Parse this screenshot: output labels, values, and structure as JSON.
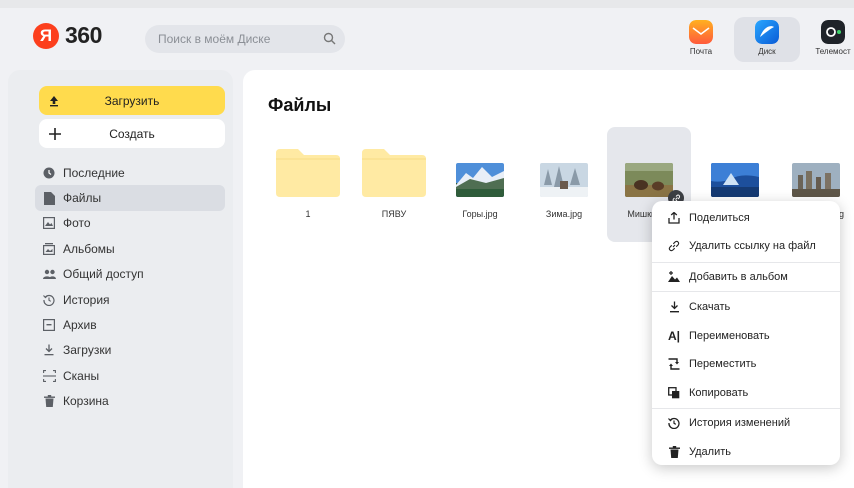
{
  "brand": {
    "logo_letter": "Я",
    "logo_text": "360"
  },
  "search": {
    "placeholder": "Поиск в моём Диске"
  },
  "apps": [
    {
      "label": "Почта",
      "icon": "mail-icon"
    },
    {
      "label": "Диск",
      "icon": "disk-icon",
      "active": true
    },
    {
      "label": "Телемост",
      "icon": "telemost-icon"
    }
  ],
  "sidebar": {
    "upload_label": "Загрузить",
    "create_label": "Создать",
    "items": [
      {
        "label": "Последние",
        "icon": "clock-icon"
      },
      {
        "label": "Файлы",
        "icon": "file-icon",
        "active": true
      },
      {
        "label": "Фото",
        "icon": "photo-icon"
      },
      {
        "label": "Альбомы",
        "icon": "albums-icon"
      },
      {
        "label": "Общий доступ",
        "icon": "shared-icon"
      },
      {
        "label": "История",
        "icon": "history-icon"
      },
      {
        "label": "Архив",
        "icon": "archive-icon"
      },
      {
        "label": "Загрузки",
        "icon": "downloads-icon"
      },
      {
        "label": "Сканы",
        "icon": "scan-icon"
      },
      {
        "label": "Корзина",
        "icon": "trash-icon"
      }
    ]
  },
  "main": {
    "title": "Файлы",
    "files": [
      {
        "name": "1",
        "kind": "folder"
      },
      {
        "name": "ПЯВУ",
        "kind": "folder"
      },
      {
        "name": "Горы.jpg",
        "kind": "image"
      },
      {
        "name": "Зима.jpg",
        "kind": "image"
      },
      {
        "name": "Мишки.jpg",
        "kind": "image",
        "selected": true
      },
      {
        "name": "",
        "kind": "image"
      },
      {
        "name": "g",
        "kind": "image"
      }
    ]
  },
  "context_menu": {
    "items": [
      {
        "label": "Поделиться",
        "icon": "share-icon"
      },
      {
        "label": "Удалить ссылку на файл",
        "icon": "unlink-icon"
      },
      {
        "label": "Добавить в альбом",
        "icon": "add-album-icon"
      },
      {
        "label": "Скачать",
        "icon": "download-icon"
      },
      {
        "label": "Переименовать",
        "icon": "rename-icon"
      },
      {
        "label": "Переместить",
        "icon": "move-icon"
      },
      {
        "label": "Копировать",
        "icon": "copy-icon"
      },
      {
        "label": "История изменений",
        "icon": "history-icon"
      },
      {
        "label": "Удалить",
        "icon": "delete-icon"
      }
    ]
  },
  "colors": {
    "accent_yellow": "#ffdb4d",
    "brand_red": "#fc3f1d",
    "folder": "#ffeaa3"
  }
}
